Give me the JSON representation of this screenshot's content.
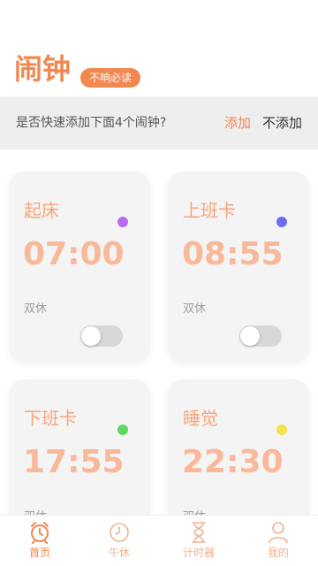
{
  "header": {
    "title": "闹钟",
    "badge": "不响必读"
  },
  "prompt": {
    "text": "是否快速添加下面4个闹钟?",
    "add_label": "添加",
    "skip_label": "不添加"
  },
  "alarms": [
    {
      "name": "起床",
      "time": "07:00",
      "repeat": "双休",
      "dot_color": "#b96cf2"
    },
    {
      "name": "上班卡",
      "time": "08:55",
      "repeat": "双休",
      "dot_color": "#6b6cf0"
    },
    {
      "name": "下班卡",
      "time": "17:55",
      "repeat": "双休",
      "dot_color": "#5ed85e"
    },
    {
      "name": "睡觉",
      "time": "22:30",
      "repeat": "双休",
      "dot_color": "#f6e24a"
    }
  ],
  "tabs": [
    {
      "label": "首页",
      "icon": "alarm-clock-icon"
    },
    {
      "label": "午休",
      "icon": "clock-icon"
    },
    {
      "label": "计时器",
      "icon": "hourglass-icon"
    },
    {
      "label": "我的",
      "icon": "person-icon"
    }
  ],
  "colors": {
    "accent": "#f2874f",
    "tab_inactive": "#f2b08e"
  }
}
